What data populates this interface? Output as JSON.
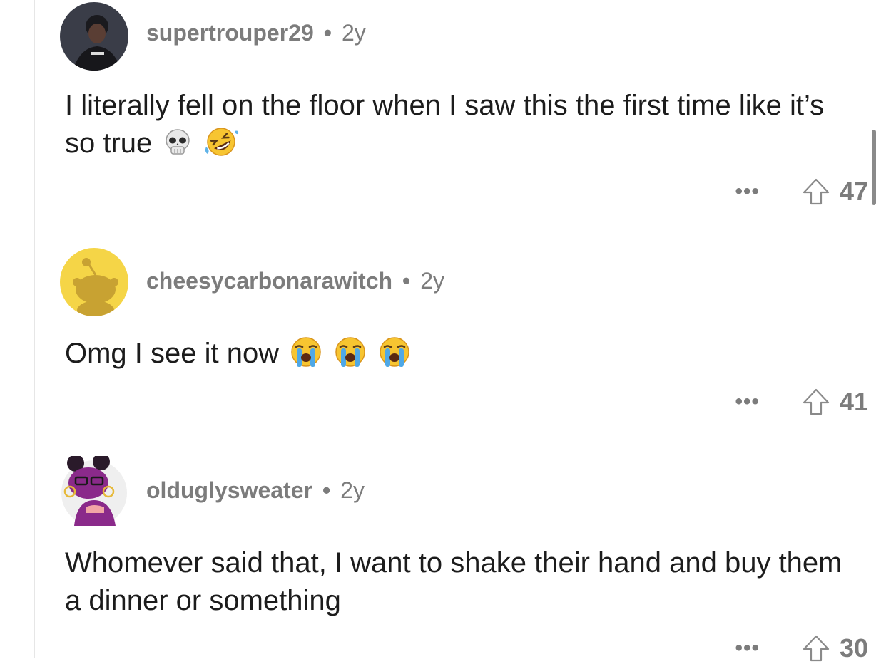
{
  "comments": [
    {
      "username": "supertrouper29",
      "separator": "•",
      "age": "2y",
      "text": "I literally fell on the floor when I saw this the first time like it’s so true",
      "emojis": [
        "skull",
        "rolling-on-floor-laughing"
      ],
      "more_label": "•••",
      "score": "47",
      "avatar": "dark-photo-avatar"
    },
    {
      "username": "cheesycarbonarawitch",
      "separator": "•",
      "age": "2y",
      "text": "Omg I see it now",
      "emojis": [
        "loudly-crying-face",
        "loudly-crying-face",
        "loudly-crying-face"
      ],
      "more_label": "•••",
      "score": "41",
      "avatar": "yellow-snoo-avatar"
    },
    {
      "username": "olduglysweater",
      "separator": "•",
      "age": "2y",
      "text": "Whomever said that, I want to shake their hand and buy them a dinner or something",
      "emojis": [],
      "more_label": "•••",
      "score": "30",
      "avatar": "purple-snoo-avatar"
    }
  ],
  "colors": {
    "meta_text": "#7c7c7c",
    "body_text": "#1c1c1c",
    "thread_line": "#e6e6e6",
    "snoo_yellow": "#f5d547",
    "snoo_purple": "#8a2a8a"
  }
}
